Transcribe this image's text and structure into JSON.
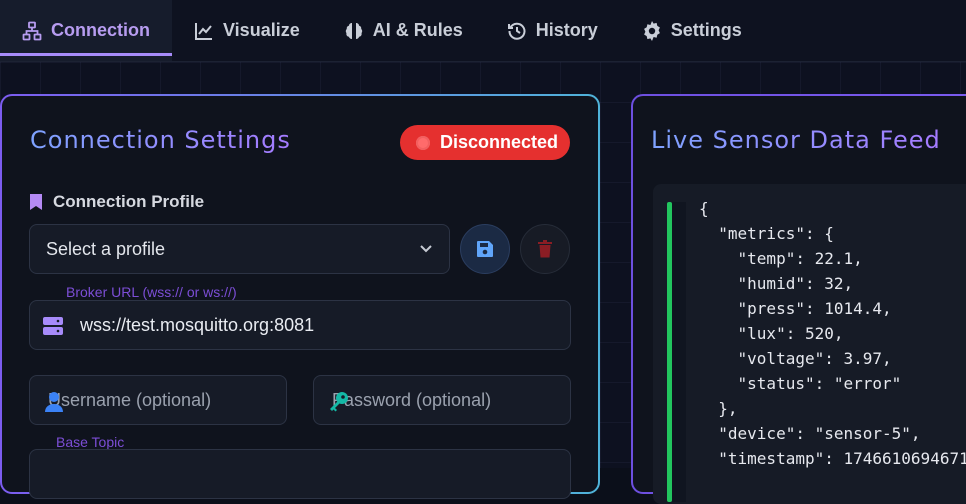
{
  "nav": {
    "tabs": [
      {
        "label": "Connection",
        "icon": "network-icon",
        "active": true
      },
      {
        "label": "Visualize",
        "icon": "chart-line-icon",
        "active": false
      },
      {
        "label": "AI & Rules",
        "icon": "brain-icon",
        "active": false
      },
      {
        "label": "History",
        "icon": "history-icon",
        "active": false
      },
      {
        "label": "Settings",
        "icon": "gear-icon",
        "active": false
      }
    ]
  },
  "connection": {
    "title": "Connection Settings",
    "status": "Disconnected",
    "status_color": "#e5302f",
    "profile_label": "Connection Profile",
    "profile_select_value": "Select a profile",
    "broker_label": "Broker URL (wss:// or ws://)",
    "broker_value": "wss://test.mosquitto.org:8081",
    "username_placeholder": "Username (optional)",
    "password_placeholder": "Password (optional)",
    "base_topic_label": "Base Topic"
  },
  "feed": {
    "title": "Live Sensor Data Feed",
    "json_text": "{\n  \"metrics\": {\n    \"temp\": 22.1,\n    \"humid\": 32,\n    \"press\": 1014.4,\n    \"lux\": 520,\n    \"voltage\": 3.97,\n    \"status\": \"error\"\n  },\n  \"device\": \"sensor-5\",\n  \"timestamp\": 1746610694671"
  },
  "colors": {
    "accent": "#a78bfa",
    "save_icon": "#60a5fa",
    "delete_icon": "#7f1d1d",
    "user_icon": "#3b82f6",
    "key_icon": "#14b8a6",
    "feed_bar": "#22c55e"
  }
}
